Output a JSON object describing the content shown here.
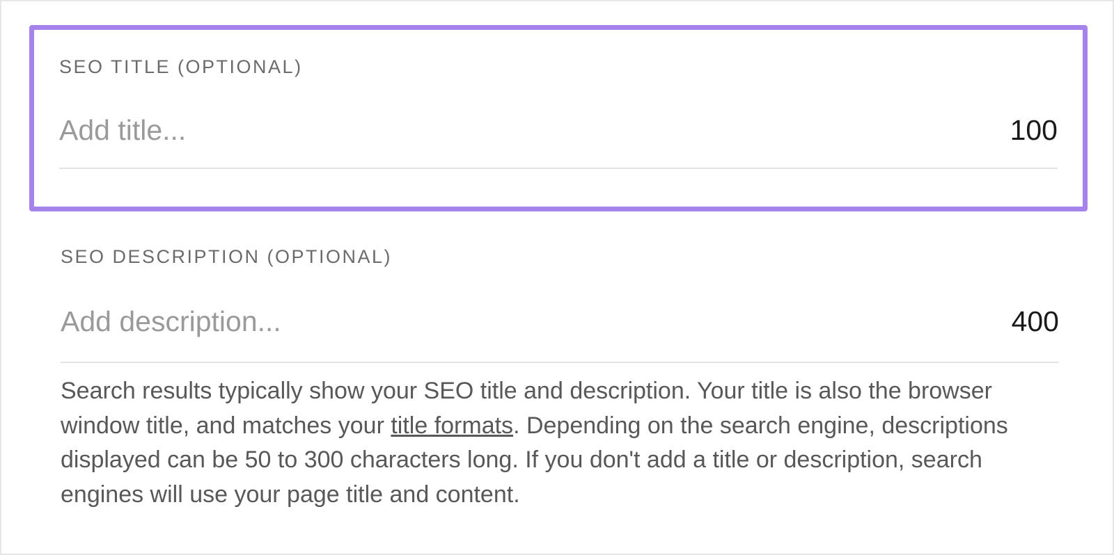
{
  "seo_title": {
    "label": "SEO TITLE (OPTIONAL)",
    "placeholder": "Add title...",
    "value": "",
    "char_limit": "100"
  },
  "seo_description": {
    "label": "SEO DESCRIPTION (OPTIONAL)",
    "placeholder": "Add description...",
    "value": "",
    "char_limit": "400"
  },
  "help": {
    "pre": "Search results typically show your SEO title and description. Your title is also the browser window title, and matches your ",
    "link": "title formats",
    "post": ". Depending on the search engine, descriptions displayed can be 50 to 300 characters long. If you don't add a title or description, search engines will use your page title and content."
  }
}
